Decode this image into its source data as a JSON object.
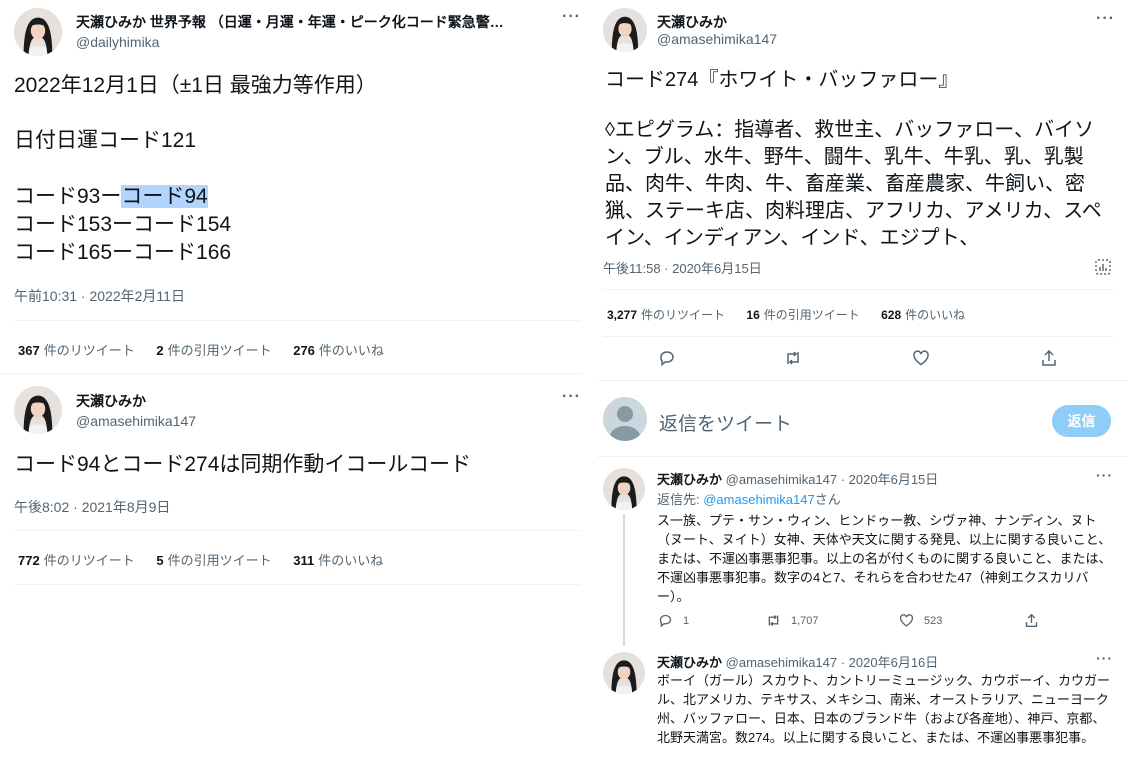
{
  "left": {
    "tweet1": {
      "name": "天瀬ひみか 世界予報 （日運・月運・年運・ピーク化コード緊急警…",
      "handle": "@dailyhimika",
      "line1": "2022年12月1日（±1日 最強力等作用）",
      "line2": "日付日運コード121",
      "line3a": "コード93ー",
      "line3b": "コード94",
      "line4": "コード153ーコード154",
      "line5": "コード165ーコード166",
      "time": "午前10:31 · 2022年2月11日",
      "stats": {
        "retweets": "367",
        "retweets_label": "件のリツイート",
        "quotes": "2",
        "quotes_label": "件の引用ツイート",
        "likes": "276",
        "likes_label": "件のいいね"
      }
    },
    "tweet2": {
      "name": "天瀬ひみか",
      "handle": "@amasehimika147",
      "text": "コード94とコード274は同期作動イコールコード",
      "time": "午後8:02 · 2021年8月9日",
      "stats": {
        "retweets": "772",
        "retweets_label": "件のリツイート",
        "quotes": "5",
        "quotes_label": "件の引用ツイート",
        "likes": "311",
        "likes_label": "件のいいね"
      }
    }
  },
  "right": {
    "main": {
      "name": "天瀬ひみか",
      "handle": "@amasehimika147",
      "title": "コード274『ホワイト・バッファロー』",
      "epigram": "◊エピグラム：指導者、救世主、バッファロー、バイソン、ブル、水牛、野牛、闘牛、乳牛、牛乳、乳、乳製品、肉牛、牛肉、牛、畜産業、畜産農家、牛飼い、密猟、ステーキ店、肉料理店、アフリカ、アメリカ、スペイン、インディアン、インド、エジプト、",
      "time": "午後11:58 · 2020年6月15日",
      "stats": {
        "retweets": "3,277",
        "retweets_label": "件のリツイート",
        "quotes": "16",
        "quotes_label": "件の引用ツイート",
        "likes": "628",
        "likes_label": "件のいいね"
      }
    },
    "compose": {
      "placeholder": "返信をツイート",
      "button": "返信"
    },
    "reply1": {
      "name": "天瀬ひみか",
      "meta": "@amasehimika147 · 2020年6月15日",
      "reply_to_label": "返信先: ",
      "reply_to_handle": "@amasehimika147",
      "reply_to_suffix": "さん",
      "text": "ス一族、プテ・サン・ウィン、ヒンドゥー教、シヴァ神、ナンディン、ヌト（ヌート、ヌイト）女神、天体や天文に関する発見、以上に関する良いこと、または、不運凶事悪事犯事。以上の名が付くものに関する良いこと、または、不運凶事悪事犯事。数字の4と7、それらを合わせた47（神剣エクスカリバー）。",
      "replies": "1",
      "retweets": "1,707",
      "likes": "523"
    },
    "reply2": {
      "name": "天瀬ひみか",
      "meta": "@amasehimika147 · 2020年6月16日",
      "text": "ボーイ（ガール）スカウト、カントリーミュージック、カウボーイ、カウガール、北アメリカ、テキサス、メキシコ、南米、オーストラリア、ニューヨーク州、バッファロー、日本、日本のブランド牛（および各産地）、神戸、京都、北野天満宮。数274。以上に関する良いこと、または、不運凶事悪事犯事。"
    }
  },
  "colors": {
    "accent": "#1d9bf0",
    "button_disabled": "#8ecdf8",
    "muted": "#536471",
    "highlight": "#b3d4fc"
  }
}
